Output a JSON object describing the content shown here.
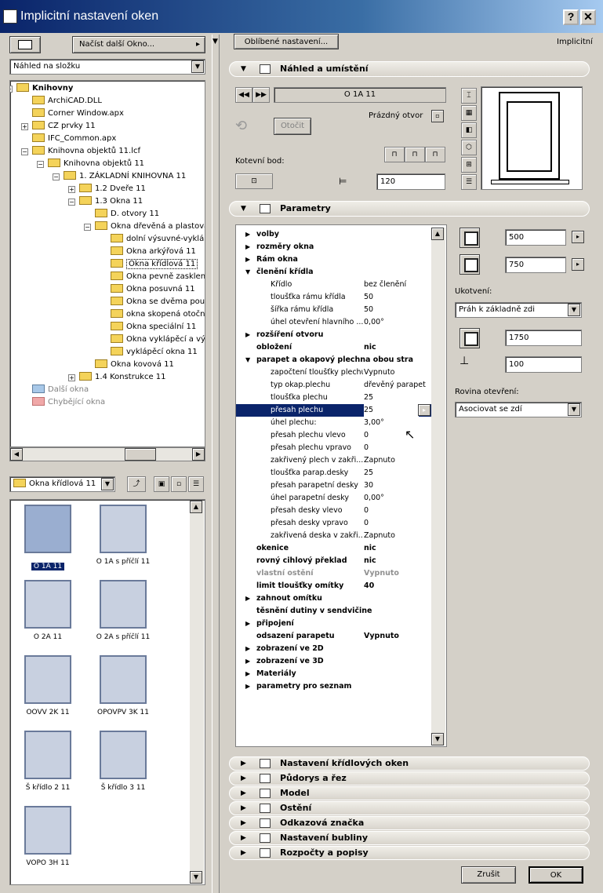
{
  "window": {
    "title": "Implicitní nastavení oken",
    "help": "?",
    "close": "✕"
  },
  "left": {
    "load_button": "Načíst další Okno...",
    "view_select": "Náhled na složku",
    "tree": [
      {
        "label": "Knihovny",
        "level": 0,
        "bold": true,
        "pm": "−"
      },
      {
        "label": "ArchiCAD.DLL",
        "level": 1
      },
      {
        "label": "Corner Window.apx",
        "level": 1
      },
      {
        "label": "CZ prvky 11",
        "level": 1,
        "pm": "+"
      },
      {
        "label": "IFC_Common.apx",
        "level": 1
      },
      {
        "label": "Knihovna objektů 11.lcf",
        "level": 1,
        "pm": "−"
      },
      {
        "label": "Knihovna objektů 11",
        "level": 2,
        "pm": "−"
      },
      {
        "label": "1. ZÁKLADNÍ KNIHOVNA 11",
        "level": 3,
        "pm": "−"
      },
      {
        "label": "1.2 Dveře 11",
        "level": 4,
        "pm": "+"
      },
      {
        "label": "1.3 Okna 11",
        "level": 4,
        "pm": "−"
      },
      {
        "label": "D. otvory 11",
        "level": 5
      },
      {
        "label": "Okna dřevěná a plastová",
        "level": 5,
        "pm": "−"
      },
      {
        "label": "dolní výsuvné-vyklápěcí",
        "level": 6
      },
      {
        "label": "Okna arkýřová 11",
        "level": 6
      },
      {
        "label": "Okna křídlová 11",
        "level": 6,
        "selected": true
      },
      {
        "label": "Okna pevně zasklená",
        "level": 6
      },
      {
        "label": "Okna posuvná 11",
        "level": 6
      },
      {
        "label": "Okna se dvěma poutci",
        "level": 6
      },
      {
        "label": "okna skopená otočná",
        "level": 6
      },
      {
        "label": "Okna speciální 11",
        "level": 6
      },
      {
        "label": "Okna vyklápěcí a výsuvná",
        "level": 6
      },
      {
        "label": "vyklápěcí okna 11",
        "level": 6
      },
      {
        "label": "Okna kovová 11",
        "level": 5
      },
      {
        "label": "1.4 Konstrukce 11",
        "level": 4,
        "pm": "+"
      },
      {
        "label": "Další okna",
        "level": 1,
        "gray": true,
        "color": "gray"
      },
      {
        "label": "Chybějící okna",
        "level": 1,
        "gray": true,
        "color": "red"
      }
    ],
    "folder_select": "Okna křídlová 11",
    "thumbnails": [
      "O 1A 11",
      "O 1A s příčlí 11",
      "O 2A 11",
      "O 2A s příčlí 11",
      "OOVV 2K 11",
      "OPOVPV 3K 11",
      "Š křídlo 2 11",
      "Š křídlo 3 11",
      "VOPO 3H 11"
    ]
  },
  "right": {
    "favorites_button": "Oblíbené nastavení...",
    "implicit_label": "Implicitní",
    "sections_top": {
      "placement": "Náhled a umístění",
      "params": "Parametry"
    },
    "placement": {
      "object_name": "O 1A 11",
      "empty_opening": "Prázdný otvor",
      "rotate_button": "Otočit",
      "anchor_label": "Kotevní bod:",
      "offset_value": "120"
    },
    "params": [
      {
        "n": "volby",
        "bold": true,
        "arrow": "▶"
      },
      {
        "n": "rozměry okna",
        "bold": true,
        "arrow": "▶"
      },
      {
        "n": "Rám okna",
        "bold": true,
        "arrow": "▶"
      },
      {
        "n": "členění křídla",
        "bold": true,
        "arrow": "▼"
      },
      {
        "n": "Křídlo",
        "v": "bez členění",
        "sub": true
      },
      {
        "n": "tloušťka rámu křídla",
        "v": "50",
        "sub": true
      },
      {
        "n": "šířka rámu křídla",
        "v": "50",
        "sub": true
      },
      {
        "n": "úhel otevření hlavního ...",
        "v": "0,00°",
        "sub": true
      },
      {
        "n": "rozšíření otvoru",
        "bold": true,
        "arrow": "▶"
      },
      {
        "n": "obložení",
        "v": "nic",
        "bold": true
      },
      {
        "n": "parapet a okapový plechna obou stra",
        "bold": true,
        "arrow": "▼"
      },
      {
        "n": "započtení tloušťky plechu",
        "v": "Vypnuto",
        "sub": true
      },
      {
        "n": "typ okap.plechu",
        "v": "dřevěný parapet",
        "sub": true
      },
      {
        "n": "tloušťka plechu",
        "v": "25",
        "sub": true
      },
      {
        "n": "přesah plechu",
        "v": "25",
        "sub": true,
        "hl": true
      },
      {
        "n": "úhel plechu:",
        "v": "3,00°",
        "sub": true
      },
      {
        "n": "přesah plechu vlevo",
        "v": "0",
        "sub": true
      },
      {
        "n": "přesah plechu vpravo",
        "v": "0",
        "sub": true
      },
      {
        "n": "zakřivený plech v zakři...",
        "v": "Zapnuto",
        "sub": true
      },
      {
        "n": "tloušťka parap.desky",
        "v": "25",
        "sub": true
      },
      {
        "n": "přesah parapetní desky",
        "v": "30",
        "sub": true
      },
      {
        "n": "úhel parapetní desky",
        "v": "0,00°",
        "sub": true
      },
      {
        "n": "přesah desky vlevo",
        "v": "0",
        "sub": true
      },
      {
        "n": "přesah desky vpravo",
        "v": "0",
        "sub": true
      },
      {
        "n": "zakřivená deska v zakři...",
        "v": "Zapnuto",
        "sub": true
      },
      {
        "n": "okenice",
        "v": "nic",
        "bold": true
      },
      {
        "n": "rovný cihlový překlad",
        "v": "nic",
        "bold": true
      },
      {
        "n": "vlastní ostění",
        "v": "Vypnuto",
        "bold": true,
        "gray": true
      },
      {
        "n": "limit tloušťky omítky",
        "v": "40",
        "bold": true
      },
      {
        "n": "zahnout omítku",
        "bold": true,
        "arrow": "▶"
      },
      {
        "n": "těsnění dutiny v sendvičine",
        "bold": true
      },
      {
        "n": "připojení",
        "bold": true,
        "arrow": "▶"
      },
      {
        "n": "odsazení parapetu",
        "v": "Vypnuto",
        "bold": true
      },
      {
        "n": "zobrazení ve 2D",
        "bold": true,
        "arrow": "▶"
      },
      {
        "n": "zobrazení ve 3D",
        "bold": true,
        "arrow": "▶"
      },
      {
        "n": "Materiály",
        "bold": true,
        "arrow": "▶"
      },
      {
        "n": "parametry pro seznam",
        "bold": true,
        "arrow": "▶"
      }
    ],
    "dims": {
      "width": "500",
      "height": "750",
      "anchor_label": "Ukotvení:",
      "anchor_select": "Práh k základně zdi",
      "sill_value": "1750",
      "reveal_value": "100",
      "opening_label": "Rovina otevření:",
      "opening_select": "Asociovat se zdí"
    },
    "sections": [
      "Nastavení křídlových oken",
      "Půdorys a řez",
      "Model",
      "Ostění",
      "Odkazová značka",
      "Nastavení bubliny",
      "Rozpočty a popisy"
    ],
    "cancel": "Zrušit",
    "ok": "OK"
  }
}
